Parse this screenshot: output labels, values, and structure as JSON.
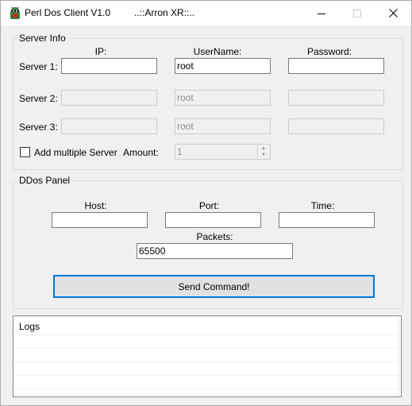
{
  "window": {
    "title": "Perl Dos Client V1.0",
    "subtitle": "..::Arron XR::.."
  },
  "server_info": {
    "title": "Server Info",
    "col_ip": "IP:",
    "col_username": "UserName:",
    "col_password": "Password:",
    "servers": [
      {
        "label": "Server 1:",
        "ip": "",
        "username": "root",
        "password": "",
        "enabled": true
      },
      {
        "label": "Server 2:",
        "ip": "",
        "username": "root",
        "password": "",
        "enabled": false
      },
      {
        "label": "Server 3:",
        "ip": "",
        "username": "root",
        "password": "",
        "enabled": false
      }
    ],
    "add_multiple_label": "Add multiple Server",
    "add_multiple_checked": false,
    "amount_label": "Amount:",
    "amount_value": "1"
  },
  "ddos_panel": {
    "title": "DDos Panel",
    "host_label": "Host:",
    "host_value": "",
    "port_label": "Port:",
    "port_value": "",
    "time_label": "Time:",
    "time_value": "",
    "packets_label": "Packets:",
    "packets_value": "65500",
    "send_label": "Send Command!"
  },
  "logs": {
    "header": "Logs"
  },
  "colors": {
    "accent": "#0078d7",
    "window_bg": "#f0f0f0",
    "disabled_text": "#8c8c8c"
  },
  "icons": {
    "app": "android-bug-icon",
    "minimize": "minimize-icon",
    "maximize": "maximize-icon",
    "close": "close-icon"
  }
}
